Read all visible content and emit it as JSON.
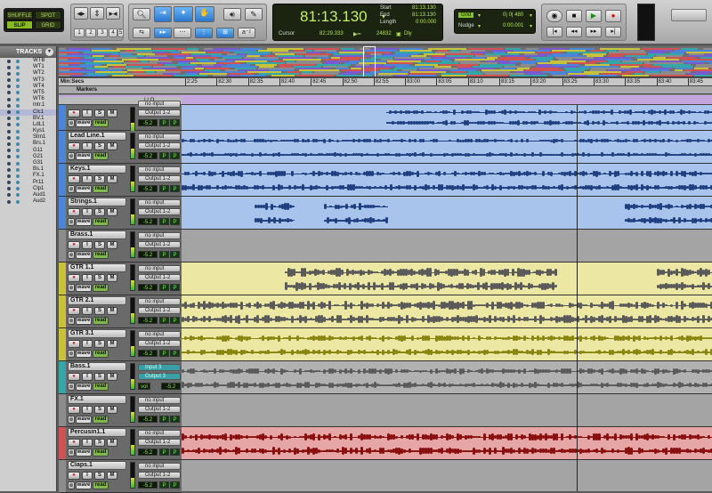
{
  "toolbar": {
    "modes": {
      "shuffle": "SHUFFLE",
      "spot": "SPOT",
      "slip": "SLIP",
      "grid": "GRID"
    },
    "zoom_presets": [
      "1",
      "2",
      "3",
      "4",
      "5"
    ],
    "counter": {
      "main": "81:13.130",
      "start_label": "Start",
      "start": "81:13.130",
      "end_label": "End",
      "end": "81:13.130",
      "length_label": "Length",
      "length": "0:00.000",
      "cursor_label": "Cursor",
      "cursor": "82:29.333",
      "samples": "24832",
      "dly_label": "Dly"
    },
    "grid": {
      "label": "Grid",
      "value": "0| 0| 480"
    },
    "nudge": {
      "label": "Nudge",
      "value": "0:00.001"
    }
  },
  "tracks_panel": {
    "title": "TRACKS",
    "items": [
      "WTB",
      "WT1",
      "WT2",
      "WT3",
      "WT4",
      "WT5",
      "WT6",
      "Intr.1",
      "Clc1",
      "BV.1",
      "LdL1",
      "Kys1",
      "Strn1",
      "Brs.1",
      "G11",
      "G21",
      "G31",
      "Bs.1",
      "FX.1",
      "Pr11",
      "Clp1",
      "Aud1",
      "Aud2"
    ]
  },
  "rulers": {
    "minsecs_label": "Min:Secs",
    "markers_label": "Markers",
    "ticks": [
      "2:25",
      "82:30",
      "82:35",
      "82:40",
      "82:45",
      "82:50",
      "82:55",
      "83:00",
      "83:05",
      "83:10",
      "83:15",
      "83:20",
      "83:25",
      "83:30",
      "83:35",
      "83:40",
      "83:45"
    ]
  },
  "edit_header": {
    "io_label": "I / O"
  },
  "track_buttons": {
    "rec": "●",
    "input": "I",
    "solo": "S",
    "mute": "M",
    "wave": "wave",
    "read": "read"
  },
  "tracks": [
    {
      "name": "",
      "in": "no input",
      "out": "Output 1-2",
      "vol": "-5.2",
      "color": "#4a86d8",
      "lane": "#a9c4ec"
    },
    {
      "name": "Lead Line.1",
      "in": "no input",
      "out": "Output 1-2",
      "vol": "-5.2",
      "color": "#4a86d8",
      "lane": "#a9c4ec"
    },
    {
      "name": "Keys.1",
      "in": "no input",
      "out": "Output 1-2",
      "vol": "-5.2",
      "color": "#4a86d8",
      "lane": "#a9c4ec"
    },
    {
      "name": "Strings.1",
      "in": "no input",
      "out": "Output 1-2",
      "vol": "-5.2",
      "color": "#4a86d8",
      "lane": "#a9c4ec"
    },
    {
      "name": "Brass.1",
      "in": "no input",
      "out": "Output 1-2",
      "vol": "-5.2",
      "color": "#8c8c8c",
      "lane": "#a4a4a4"
    },
    {
      "name": "GTR 1.1",
      "in": "no input",
      "out": "Output 1-2",
      "vol": "-5.2",
      "color": "#c8c23a",
      "lane": "#ece8a3"
    },
    {
      "name": "GTR 2.1",
      "in": "no input",
      "out": "Output 1-2",
      "vol": "-5.2",
      "color": "#c8c23a",
      "lane": "#ece8a3"
    },
    {
      "name": "GTR 3.1",
      "in": "no input",
      "out": "Output 1-2",
      "vol": "-5.2",
      "color": "#c8c23a",
      "lane": "#ece8a3"
    },
    {
      "name": "Bass.1",
      "in": "Input 3",
      "out": "Output 3",
      "vol": "-5.2",
      "vol_label": "vol",
      "color": "#35a6a6",
      "lane": "#b1b1b1"
    },
    {
      "name": "FX.1",
      "in": "no input",
      "out": "Output 1-2",
      "vol": "-5.2",
      "color": "#8c8c8c",
      "lane": "#a4a4a4"
    },
    {
      "name": "Percusin1.1",
      "in": "no input",
      "out": "Output 1-2",
      "vol": "-5.2",
      "color": "#d05252",
      "lane": "#e7a6a6"
    },
    {
      "name": "Claps.1",
      "in": "no input",
      "out": "Output 1-2",
      "vol": "-5.2",
      "color": "#8c8c8c",
      "lane": "#a4a4a4"
    }
  ],
  "colors": {
    "audio_blue": "#1f3f80",
    "audio_olive": "#8a8410",
    "audio_gray": "#5a5a5a",
    "audio_red": "#8a1010",
    "selection_bar": "#c5a7dd"
  }
}
